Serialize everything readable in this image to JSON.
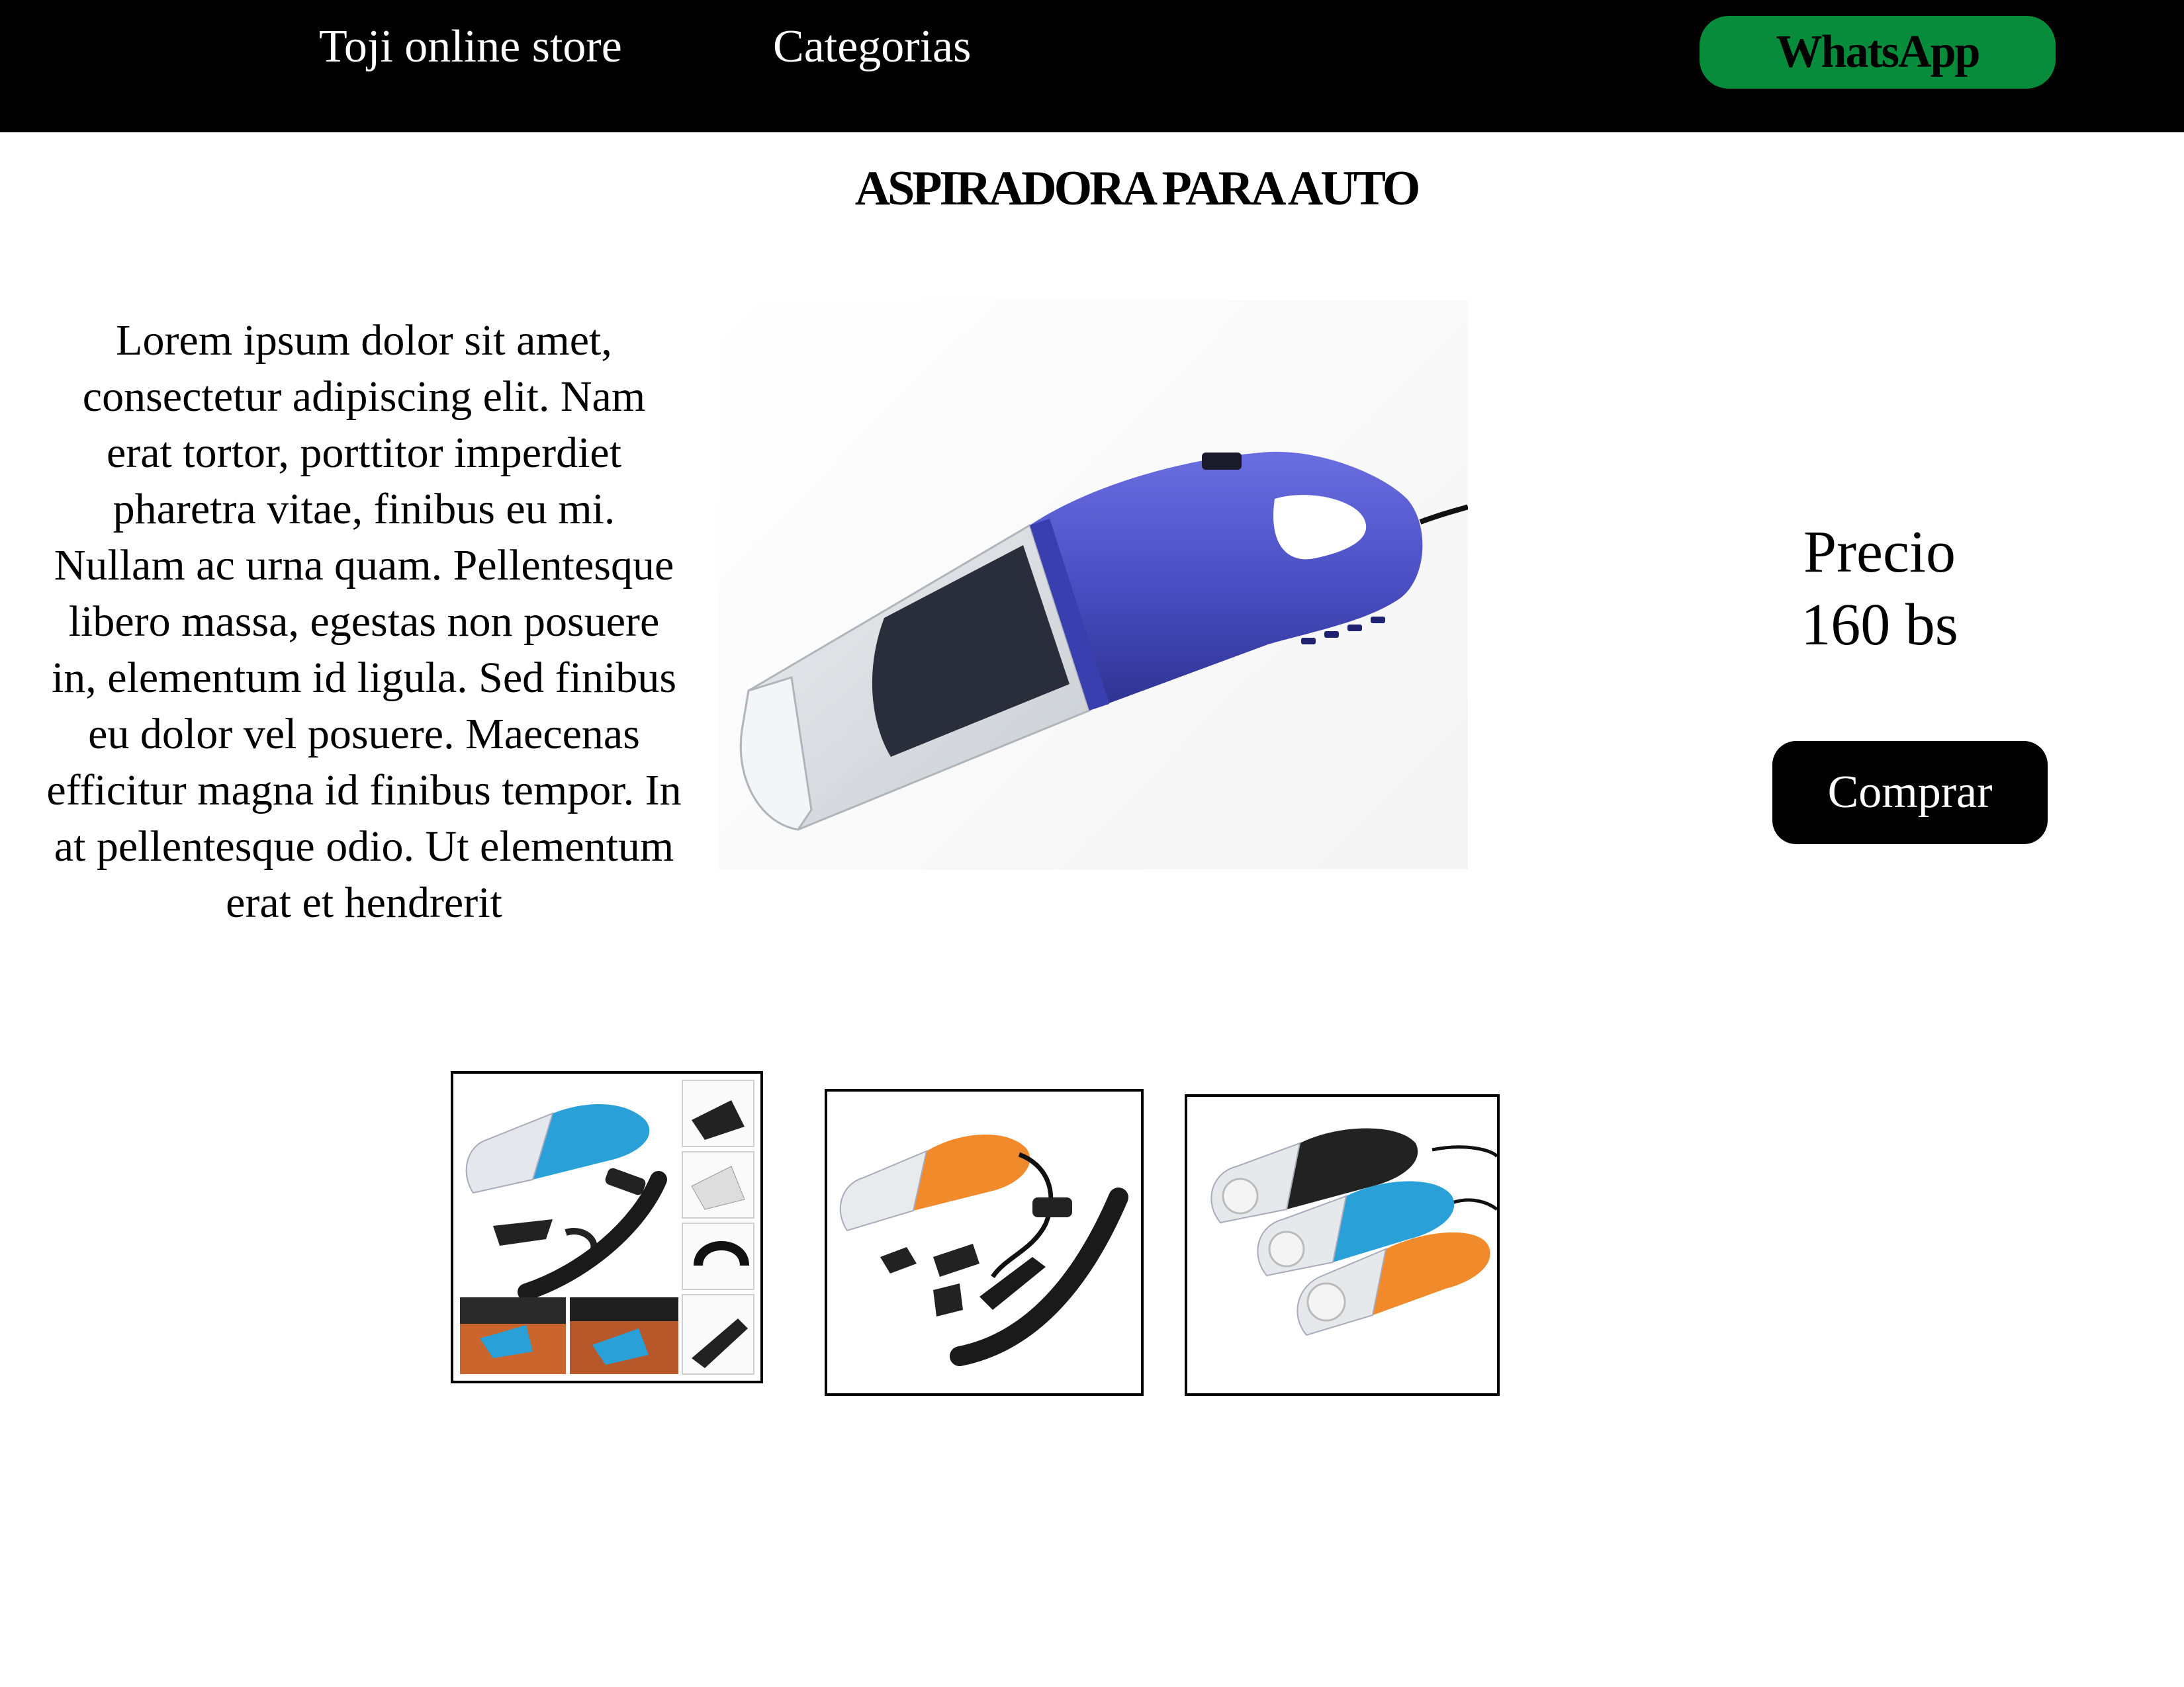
{
  "header": {
    "store_name": "Toji online store",
    "categories_label": "Categorias",
    "whatsapp_label": "WhatsApp",
    "whatsapp_color": "#068c3a",
    "background_color": "#000000"
  },
  "product": {
    "title": "ASPIRADORA PARA AUTO",
    "description": "Lorem ipsum dolor sit amet, consectetur adipiscing elit. Nam erat tortor, porttitor imperdiet pharetra vitae, finibus eu mi. Nullam ac urna quam. Pellentesque libero massa, egestas non posuere in, elementum id ligula. Sed finibus eu dolor vel posuere. Maecenas efficitur magna id finibus tempor. In at pellentesque odio. Ut elementum erat et hendrerit",
    "price_label": "Precio",
    "price_value": "160 bs",
    "buy_label": "Comprar",
    "main_image_color": "#4a4fc4",
    "thumbnails": [
      {
        "icon": "vacuum-accessories-collage-icon",
        "color": "#2aa0d8"
      },
      {
        "icon": "vacuum-orange-kit-icon",
        "color": "#f08a2a"
      },
      {
        "icon": "vacuum-three-colors-icon",
        "color": "#222222"
      }
    ]
  }
}
